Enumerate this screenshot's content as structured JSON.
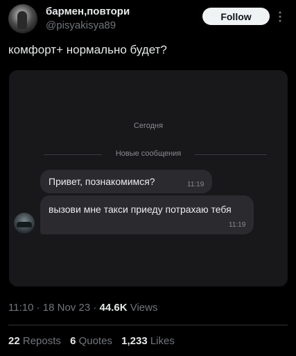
{
  "author": {
    "name": "бармен,повтори",
    "handle": "@pisyakisya89",
    "follow_label": "Follow"
  },
  "tweet": {
    "text": "комфорт+ нормально будет?"
  },
  "chat_screenshot": {
    "date_label": "Сегодня",
    "new_messages_label": "Новые сообщения",
    "messages": [
      {
        "text": "Привет, познакомимся?",
        "time": "11:19"
      },
      {
        "text": "вызови мне такси приеду потрахаю тебя",
        "time": "11:19"
      }
    ]
  },
  "meta": {
    "time": "11:10",
    "separator": "·",
    "date": "18 Nov 23",
    "views_count": "44.6K",
    "views_label": "Views"
  },
  "stats": {
    "reposts_count": "22",
    "reposts_label": "Reposts",
    "quotes_count": "6",
    "quotes_label": "Quotes",
    "likes_count": "1,233",
    "likes_label": "Likes"
  },
  "icons": {
    "more": "more-vertical-icon"
  },
  "colors": {
    "background": "#000000",
    "text": "#e7e9ea",
    "secondary_text": "#71767b",
    "follow_button_bg": "#eff3f4",
    "chat_background": "#18181b",
    "bubble": "#2b2b2f"
  }
}
